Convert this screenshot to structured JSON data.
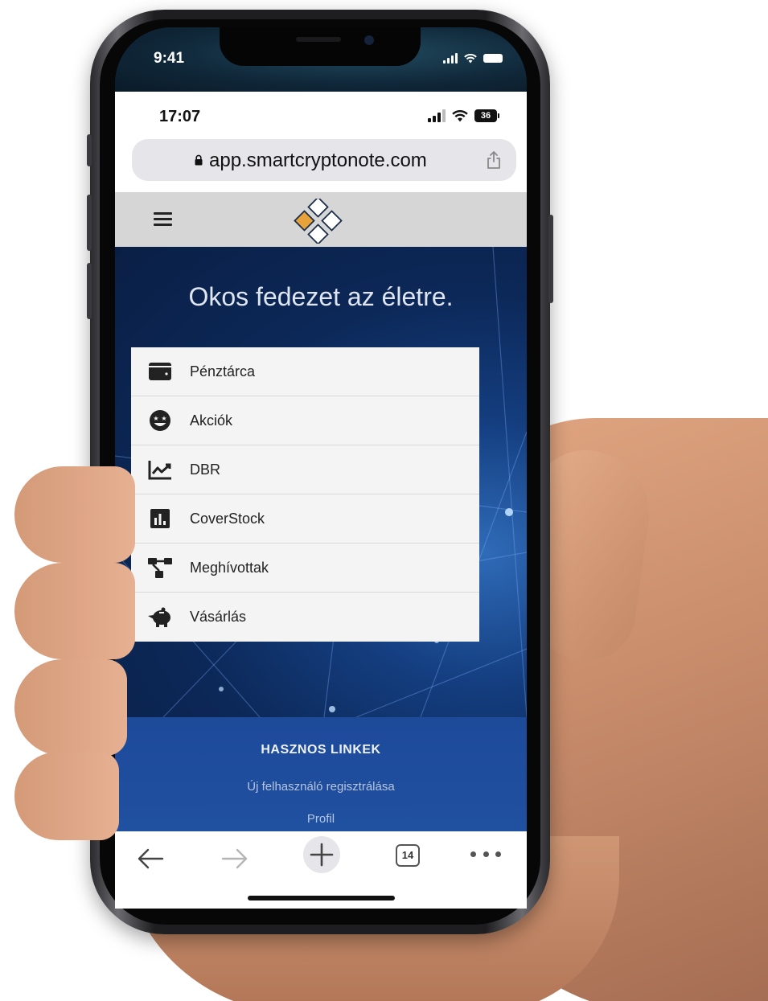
{
  "outer_status": {
    "time": "9:41"
  },
  "browser_status": {
    "time": "17:07",
    "battery": "36"
  },
  "url_bar": {
    "url": "app.smartcryptonote.com"
  },
  "hero": {
    "title": "Okos fedezet az életre."
  },
  "menu": {
    "items": [
      {
        "label": "Pénztárca",
        "icon": "wallet-icon"
      },
      {
        "label": "Akciók",
        "icon": "star-eyes-face-icon"
      },
      {
        "label": "DBR",
        "icon": "trending-chart-icon"
      },
      {
        "label": "CoverStock",
        "icon": "bar-chart-icon"
      },
      {
        "label": "Meghívottak",
        "icon": "network-tree-icon"
      },
      {
        "label": "Vásárlás",
        "icon": "piggy-bank-icon"
      }
    ]
  },
  "footer": {
    "title": "HASZNOS LINKEK",
    "links": [
      "Új felhasználó regisztrálása",
      "Profil"
    ]
  },
  "toolbar": {
    "tab_count": "14"
  },
  "colors": {
    "hero_bg": "#0c2858",
    "footer_bg": "#1e4a9a",
    "logo_accent": "#e8a23a",
    "menu_bg": "#f4f4f4",
    "nav_bg": "#d6d6d6"
  }
}
